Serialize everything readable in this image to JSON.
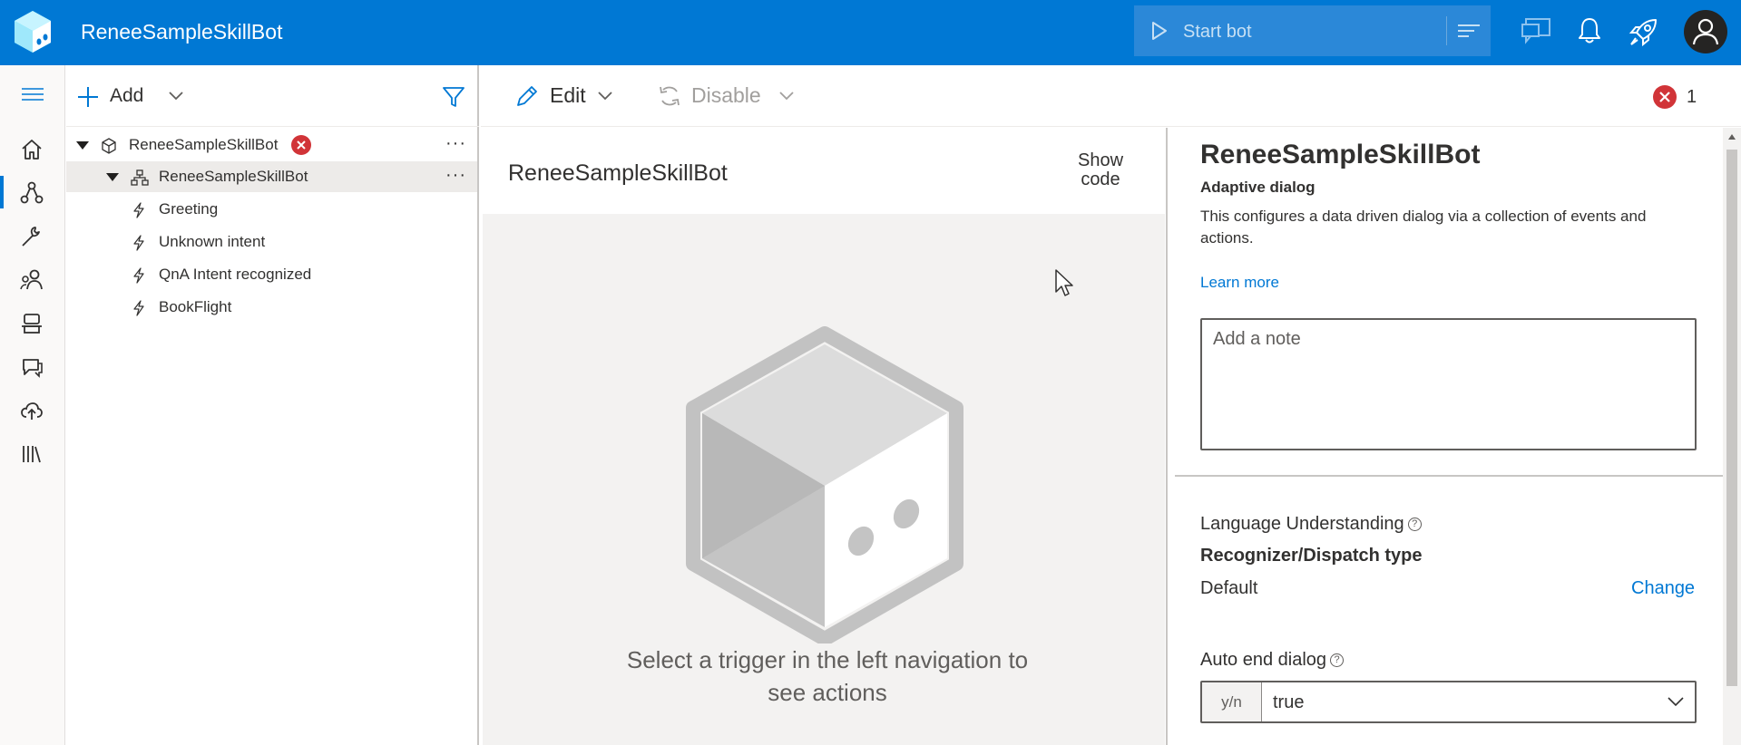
{
  "header": {
    "app_title": "ReneeSampleSkillBot",
    "start_bot_label": "Start bot",
    "brand_color": "#0078d4"
  },
  "rail": {
    "items": [
      "home-icon",
      "design-icon",
      "configure-icon",
      "users-icon",
      "bot-responses-icon",
      "knowledge-icon",
      "publish-icon",
      "library-icon"
    ],
    "active_index": 1
  },
  "tree": {
    "add_label": "Add",
    "items": [
      {
        "label": "ReneeSampleSkillBot",
        "kind": "bot",
        "has_error": true
      },
      {
        "label": "ReneeSampleSkillBot",
        "kind": "dialog",
        "selected": true
      },
      {
        "label": "Greeting",
        "kind": "trigger"
      },
      {
        "label": "Unknown intent",
        "kind": "trigger"
      },
      {
        "label": "QnA Intent recognized",
        "kind": "trigger"
      },
      {
        "label": "BookFlight",
        "kind": "trigger"
      }
    ],
    "more_label": "···"
  },
  "toolbar": {
    "edit_label": "Edit",
    "disable_label": "Disable",
    "error_count": "1"
  },
  "canvas": {
    "title": "ReneeSampleSkillBot",
    "show_code_label": "Show code",
    "empty_message": "Select a trigger in the left navigation to see actions"
  },
  "properties": {
    "title": "ReneeSampleSkillBot",
    "subtitle": "Adaptive dialog",
    "description": "This configures a data driven dialog via a collection of events and actions.",
    "learn_more": "Learn more",
    "note_placeholder": "Add a note",
    "language_understanding_label": "Language Understanding",
    "recognizer_label": "Recognizer/Dispatch type",
    "recognizer_value": "Default",
    "change_label": "Change",
    "auto_end_label": "Auto end dialog",
    "auto_end_type": "y/n",
    "auto_end_value": "true"
  }
}
